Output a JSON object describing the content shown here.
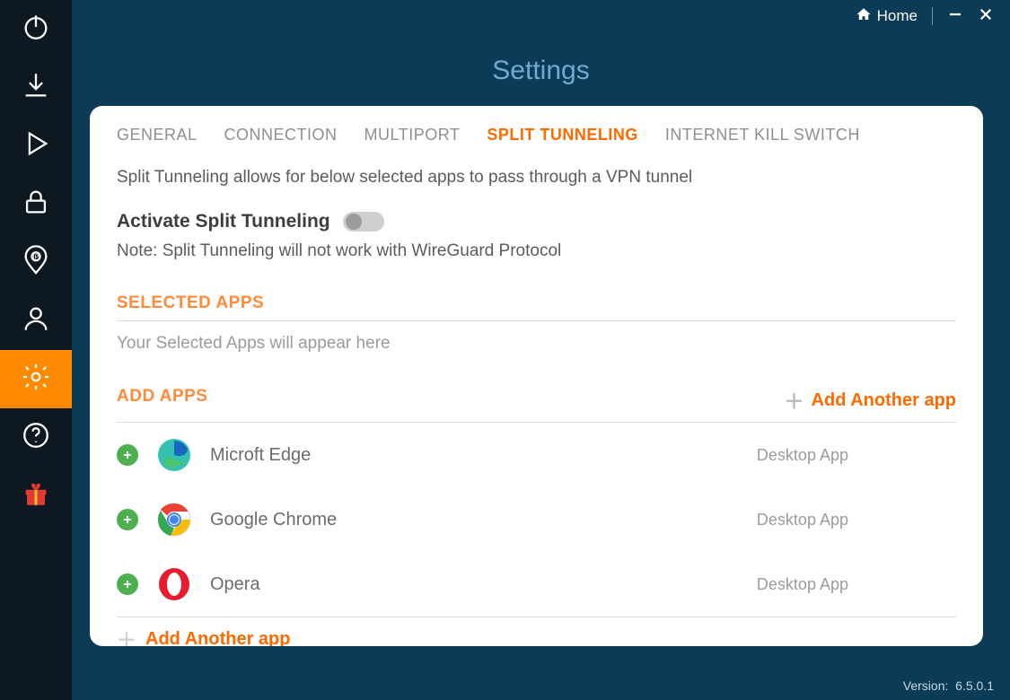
{
  "window": {
    "home_label": "Home",
    "page_title": "Settings",
    "version_label": "Version:",
    "version_value": "6.5.0.1"
  },
  "rail": {
    "items": [
      {
        "name": "power-icon"
      },
      {
        "name": "download-icon"
      },
      {
        "name": "play-icon"
      },
      {
        "name": "lock-icon"
      },
      {
        "name": "ip-location-icon"
      },
      {
        "name": "profile-icon"
      },
      {
        "name": "settings-gear-icon",
        "active": true
      },
      {
        "name": "help-icon"
      },
      {
        "name": "gift-icon"
      }
    ]
  },
  "tabs": [
    {
      "label": "GENERAL"
    },
    {
      "label": "CONNECTION"
    },
    {
      "label": "MULTIPORT"
    },
    {
      "label": "SPLIT TUNNELING",
      "active": true
    },
    {
      "label": "INTERNET KILL SWITCH"
    }
  ],
  "split": {
    "description": "Split Tunneling allows for below selected apps to pass through a VPN tunnel",
    "activate_label": "Activate Split Tunneling",
    "activate_on": false,
    "note": "Note: Split Tunneling will not work with WireGuard Protocol",
    "selected_header": "SELECTED APPS",
    "selected_empty": "Your Selected Apps will appear here",
    "add_header": "ADD APPS",
    "add_another_label": "Add Another app",
    "apps": [
      {
        "name": "Microft Edge",
        "type": "Desktop App",
        "icon": "edge"
      },
      {
        "name": "Google Chrome",
        "type": "Desktop App",
        "icon": "chrome"
      },
      {
        "name": "Opera",
        "type": "Desktop App",
        "icon": "opera"
      }
    ]
  }
}
